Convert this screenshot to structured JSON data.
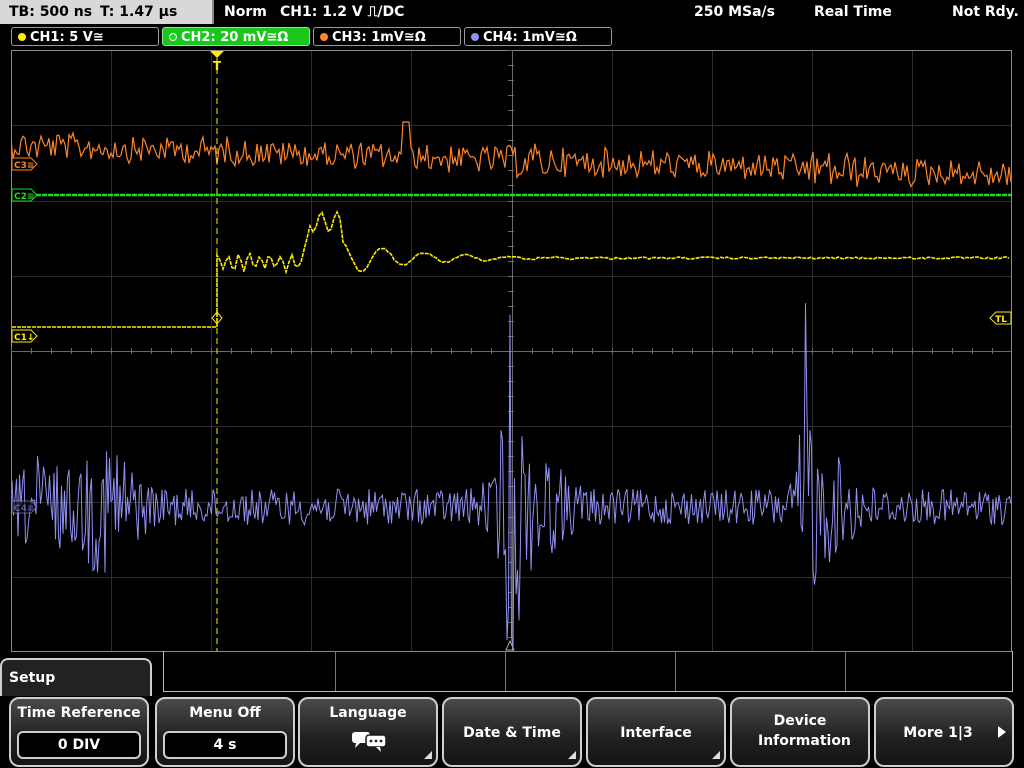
{
  "status": {
    "timebase": "TB: 500 ns",
    "trigger_time": "T: 1.47 µs",
    "mode": "Norm",
    "trigger_info": "CH1: 1.2 V ⎍/DC",
    "sample_rate": "250 MSa/s",
    "acq_mode": "Real Time",
    "state": "Not Rdy."
  },
  "channels": [
    {
      "label": "CH1: 5 V≅",
      "color": "#ffeb00",
      "active": false
    },
    {
      "label": "CH2: 20 mV≅Ω",
      "color": "#1fd821",
      "active": true
    },
    {
      "label": "CH3: 1mV≅Ω",
      "color": "#ff8426",
      "active": false
    },
    {
      "label": "CH4: 1mV≅Ω",
      "color": "#9090f0",
      "active": false
    }
  ],
  "markers": {
    "c3": "C3≡",
    "c2": "C2≡",
    "c1": "C1↓",
    "c4": "C4≡",
    "trigger_level": "TL",
    "trigger_pos": "T"
  },
  "menu": {
    "title": "Setup",
    "softkeys": [
      {
        "title": "Time Reference",
        "value": "0 DIV"
      },
      {
        "title": "Menu Off",
        "value": "4 s"
      },
      {
        "title": "Language",
        "icon": "speech-bubbles-icon"
      },
      {
        "title": "Date & Time"
      },
      {
        "title": "Interface"
      },
      {
        "title": "Device Information"
      },
      {
        "title": "More 1|3"
      }
    ]
  }
}
